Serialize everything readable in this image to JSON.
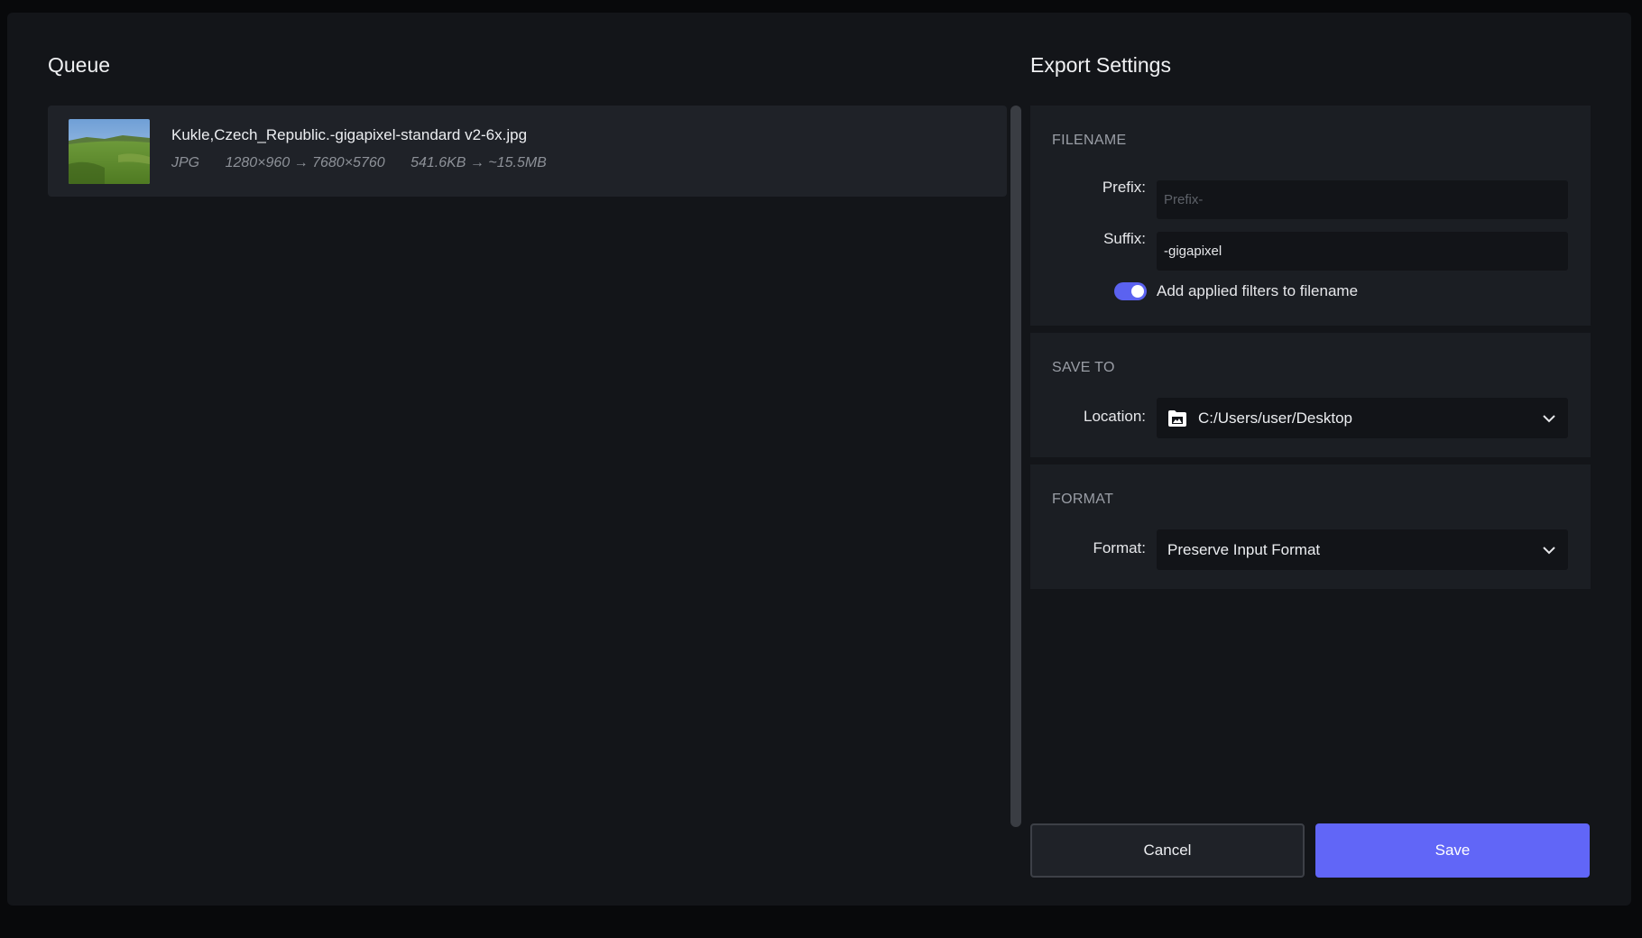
{
  "queue": {
    "title": "Queue",
    "items": [
      {
        "filename": "Kukle,Czech_Republic.-gigapixel-standard v2-6x.jpg",
        "format": "JPG",
        "dimensions": "1280×960 → 7680×5760",
        "size": "541.6KB → ~15.5MB",
        "thumbnail_icon": "landscape-thumbnail"
      }
    ]
  },
  "export_settings": {
    "title": "Export Settings",
    "filename": {
      "section_label": "FILENAME",
      "prefix_label": "Prefix:",
      "prefix_value": "",
      "prefix_placeholder": "Prefix-",
      "suffix_label": "Suffix:",
      "suffix_value": "-gigapixel",
      "toggle_label": "Add applied filters to filename",
      "toggle_on": true
    },
    "save_to": {
      "section_label": "SAVE TO",
      "location_label": "Location:",
      "location_value": "C:/Users/user/Desktop",
      "icon": "folder-icon"
    },
    "format": {
      "section_label": "FORMAT",
      "format_label": "Format:",
      "format_value": "Preserve Input Format"
    }
  },
  "actions": {
    "cancel_label": "Cancel",
    "save_label": "Save"
  },
  "colors": {
    "accent": "#6166f7",
    "background": "#131519",
    "panel": "#1b1e23"
  }
}
